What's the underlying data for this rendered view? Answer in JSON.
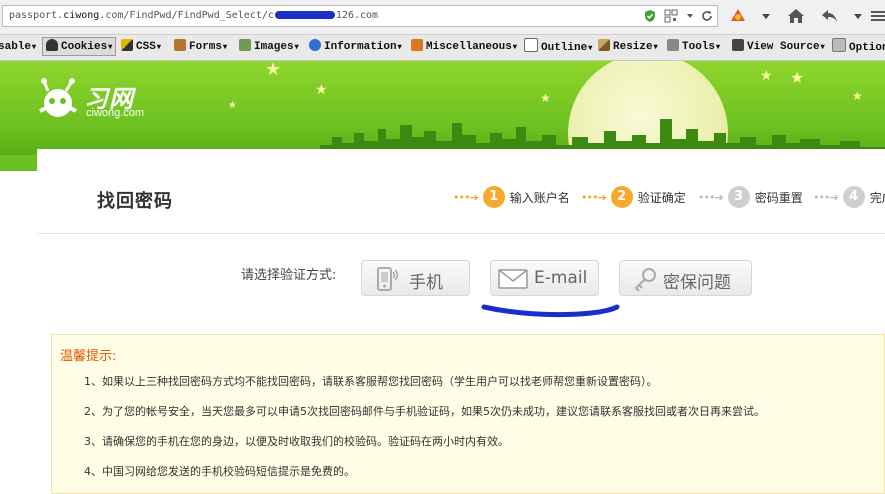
{
  "browser": {
    "url_prefix": "passport.",
    "url_host": "ciwong",
    "url_mid": ".com/FindPwd/FindPwd_Select/",
    "url_redacted_start": "c",
    "url_suffix": "126.com"
  },
  "devtoolbar": {
    "items": [
      {
        "label": "sable",
        "icon": "disable-icon",
        "active": false
      },
      {
        "label": "Cookies",
        "icon": "cookies-icon",
        "active": true
      },
      {
        "label": "CSS",
        "icon": "css-icon",
        "active": false
      },
      {
        "label": "Forms",
        "icon": "forms-icon",
        "active": false
      },
      {
        "label": "Images",
        "icon": "images-icon",
        "active": false
      },
      {
        "label": "Information",
        "icon": "information-icon",
        "active": false
      },
      {
        "label": "Miscellaneous",
        "icon": "miscellaneous-icon",
        "active": false
      },
      {
        "label": "Outline",
        "icon": "outline-icon",
        "active": false
      },
      {
        "label": "Resize",
        "icon": "resize-icon",
        "active": false
      },
      {
        "label": "Tools",
        "icon": "tools-icon",
        "active": false
      },
      {
        "label": "View Source",
        "icon": "view-source-icon",
        "active": false
      },
      {
        "label": "Option",
        "icon": "options-icon",
        "active": false
      }
    ]
  },
  "site": {
    "logo_text": "习网",
    "logo_sub": "ciwong.com"
  },
  "page": {
    "title": "找回密码",
    "steps": [
      {
        "num": "1",
        "label": "输入账户名",
        "state": "done"
      },
      {
        "num": "2",
        "label": "验证确定",
        "state": "done"
      },
      {
        "num": "3",
        "label": "密码重置",
        "state": "todo"
      },
      {
        "num": "4",
        "label": "完成",
        "state": "todo"
      }
    ],
    "method_label": "请选择验证方式:",
    "methods": {
      "phone": "手机",
      "email": "E-mail",
      "question": "密保问题"
    }
  },
  "tips": {
    "title": "温馨提示:",
    "items": [
      "1、如果以上三种找回密码方式均不能找回密码，请联系客服帮您找回密码（学生用户可以找老师帮您重新设置密码）。",
      "2、为了您的帐号安全，当天您最多可以申请5次找回密码邮件与手机验证码，如果5次仍未成功，建议您请联系客服找回或者次日再来尝试。",
      "3、请确保您的手机在您的身边，以便及时收取我们的校验码。验证码在两小时内有效。",
      "4、中国习网给您发送的手机校验码短信提示是免费的。"
    ]
  },
  "colors": {
    "header_green": "#6cc01f",
    "step_done": "#f7a82b",
    "step_todo": "#cfcfcf",
    "tip_title": "#e05a00",
    "annotation_blue": "#1a2fc9"
  }
}
